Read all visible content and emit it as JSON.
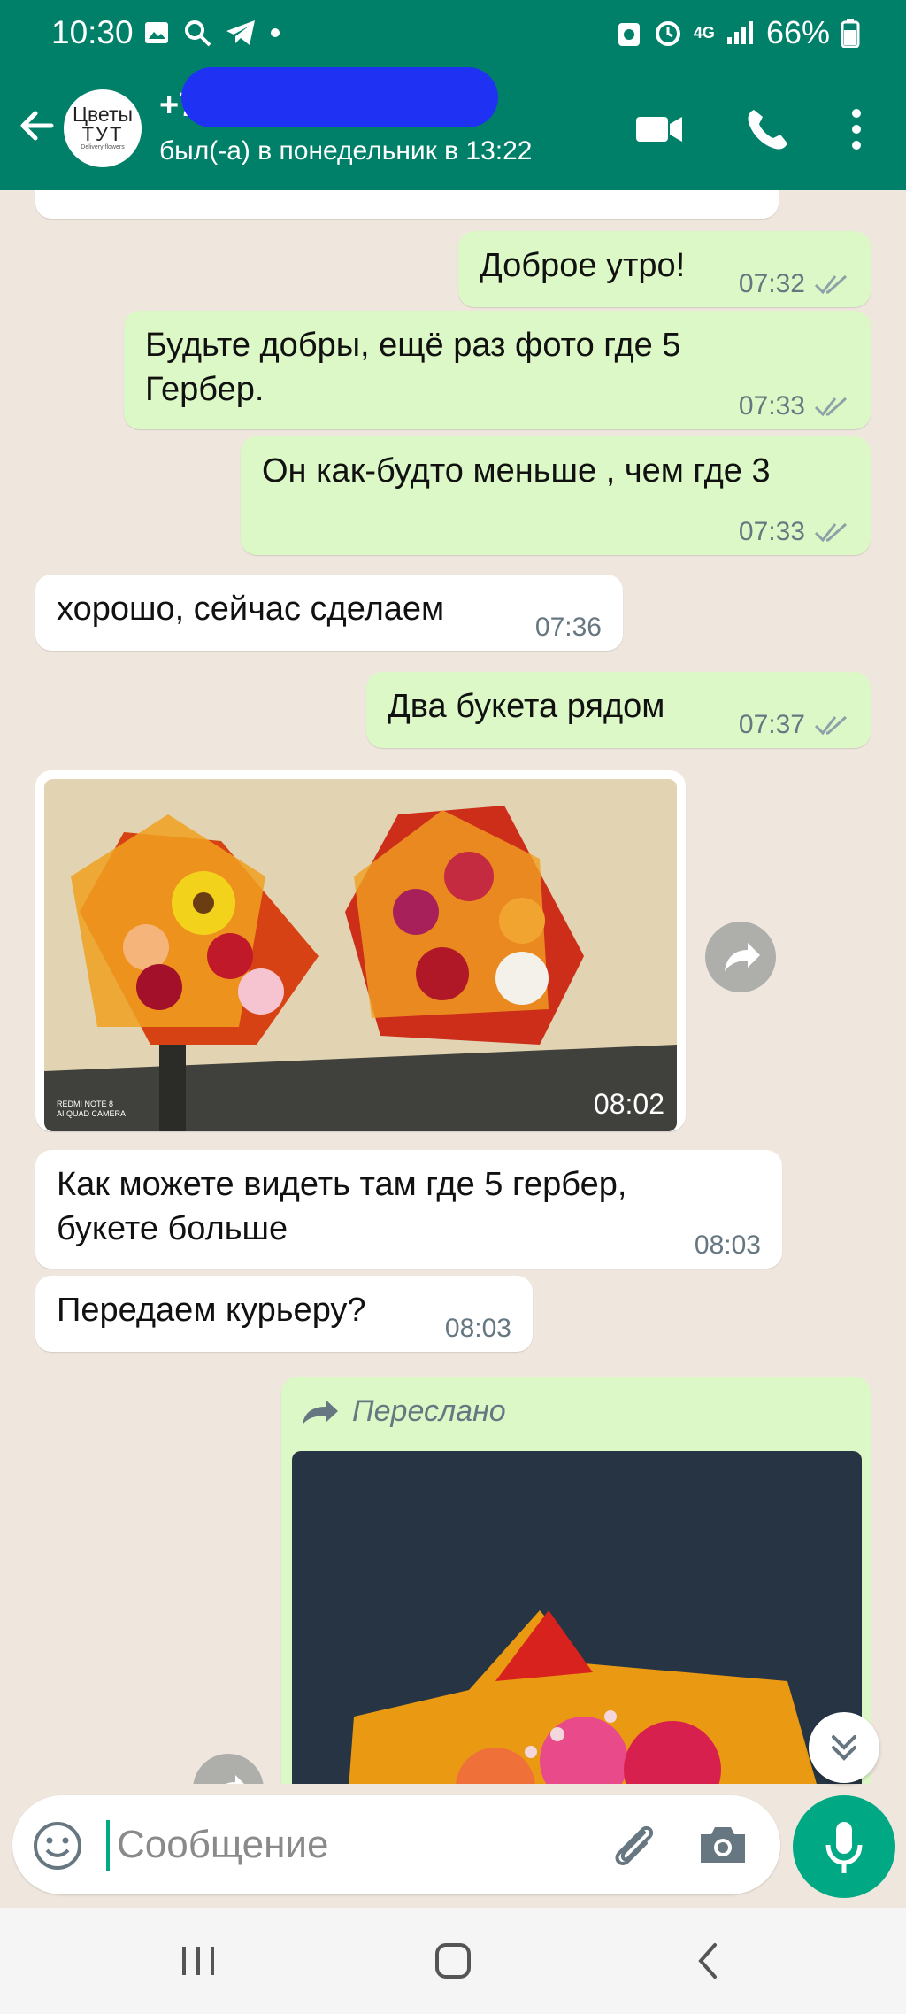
{
  "status_bar": {
    "time": "10:30",
    "network": "4G",
    "battery": "66%",
    "icons": [
      "image-icon",
      "search-icon",
      "telegram-icon",
      "dot-icon",
      "recycle-icon",
      "alarm-icon",
      "network-4g-icon",
      "signal-icon",
      "battery-icon"
    ]
  },
  "header": {
    "avatar_line1": "Цветы",
    "avatar_line2": "ТУТ",
    "avatar_line3": "Delivery flowers",
    "contact_name": "+7",
    "last_seen": "был(-а) в понедельник в 13:22",
    "icons": [
      "back-arrow-icon",
      "video-call-icon",
      "phone-icon",
      "more-vert-icon"
    ]
  },
  "messages": [
    {
      "dir": "out",
      "text": "Доброе утро!",
      "time": "07:32",
      "read": true
    },
    {
      "dir": "out",
      "text": "Будьте добры, ещё раз фото где 5 Гербер.",
      "time": "07:33",
      "read": true
    },
    {
      "dir": "out",
      "text": "Он как-будто меньше , чем где 3",
      "time": "07:33",
      "read": true
    },
    {
      "dir": "in",
      "text": "хорошо, сейчас сделаем",
      "time": "07:36"
    },
    {
      "dir": "out",
      "text": "Два букета рядом",
      "time": "07:37",
      "read": true
    },
    {
      "dir": "in",
      "type": "photo",
      "time": "08:02",
      "watermark": "REDMI NOTE 8 AI QUAD CAMERA"
    },
    {
      "dir": "in",
      "text": "Как можете видеть там где 5 гербер, букете больше",
      "time": "08:03"
    },
    {
      "dir": "in",
      "text": "Передаем курьеру?",
      "time": "08:03"
    },
    {
      "dir": "out",
      "type": "forwarded_photo",
      "forwarded_label": "Переслано"
    }
  ],
  "text_lines": {
    "m2_l1": "Будьте добры, ещё раз фото где 5",
    "m2_l2": "Гербер.",
    "m7_l1": "Как можете видеть там где 5 гербер,",
    "m7_l2": "букете больше",
    "wm_l1": "REDMI NOTE 8",
    "wm_l2": "AI QUAD CAMERA"
  },
  "composer": {
    "placeholder": "Сообщение"
  },
  "colors": {
    "header": "#008069",
    "outgoing_bubble": "#dcf8c6",
    "incoming_bubble": "#ffffff",
    "accent": "#00a884",
    "chat_background": "#efe7de"
  }
}
